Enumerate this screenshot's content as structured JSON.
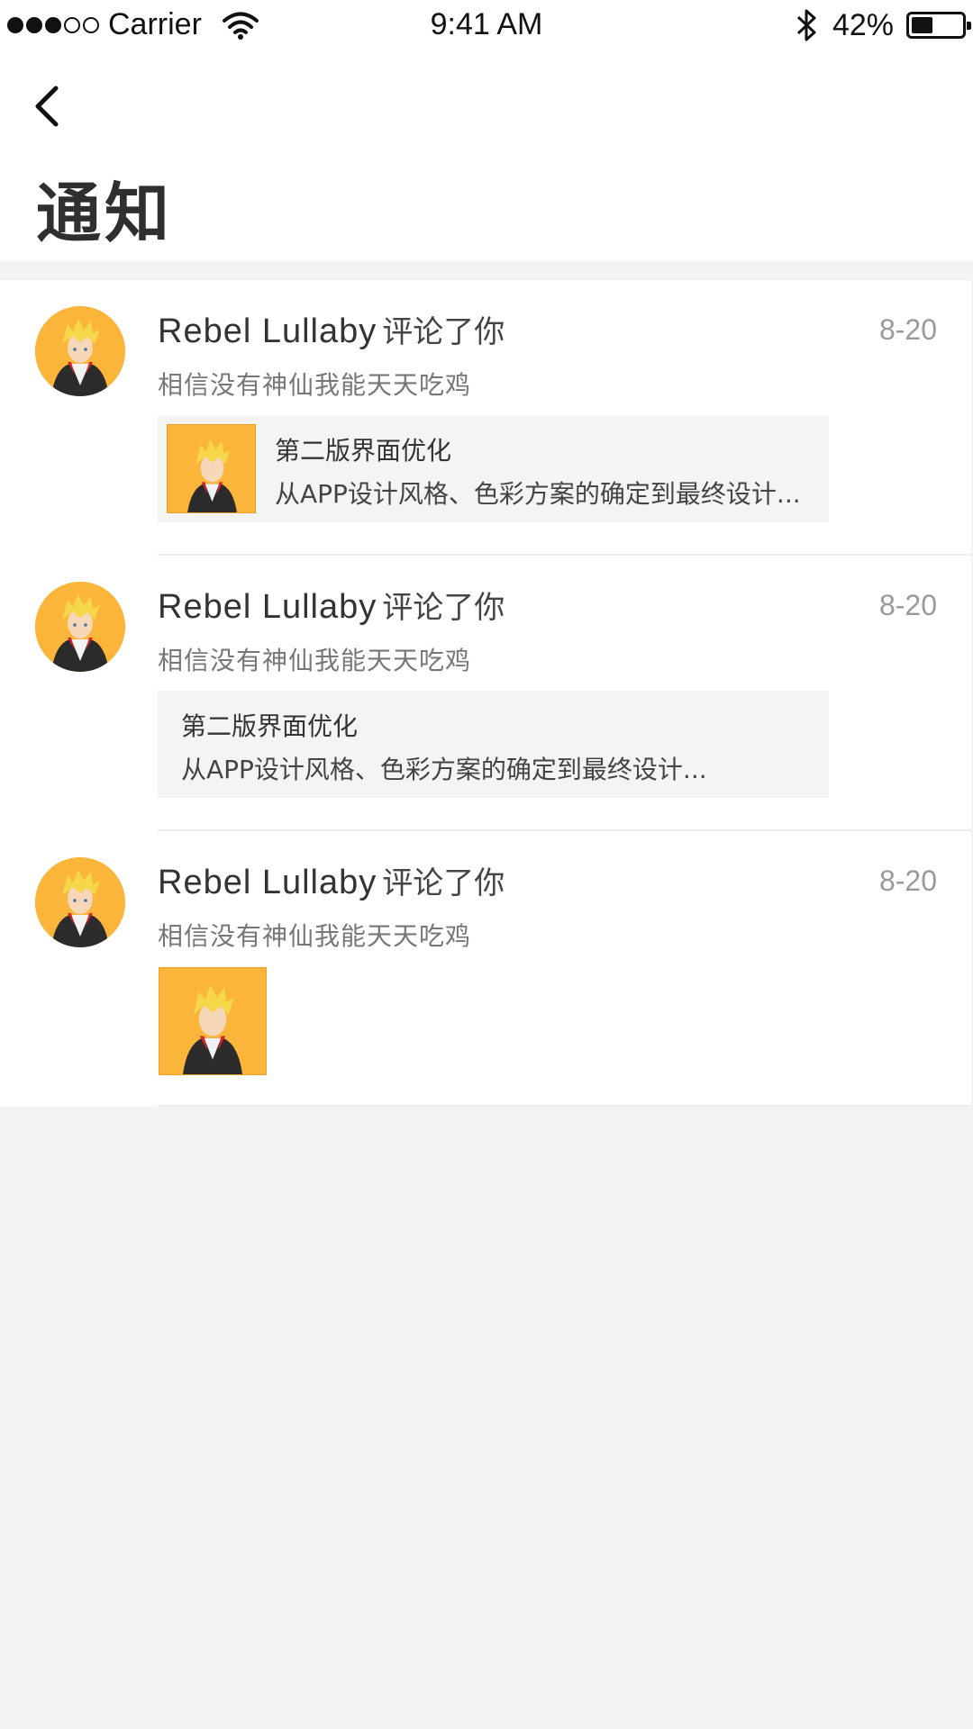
{
  "status_bar": {
    "carrier": "Carrier",
    "time": "9:41 AM",
    "battery": "42%",
    "battery_level": 0.42
  },
  "header": {
    "title": "通知"
  },
  "notifications": [
    {
      "name": "Rebel Lullaby",
      "action": "评论了你",
      "date": "8-20",
      "comment": "相信没有神仙我能天天吃鸡",
      "card": {
        "title": "第二版界面优化",
        "desc": "从APP设计风格、色彩方案的确定到最终设计..."
      }
    },
    {
      "name": "Rebel Lullaby",
      "action": "评论了你",
      "date": "8-20",
      "comment": "相信没有神仙我能天天吃鸡",
      "card": {
        "title": "第二版界面优化",
        "desc": "从APP设计风格、色彩方案的确定到最终设计..."
      }
    },
    {
      "name": "Rebel Lullaby",
      "action": "评论了你",
      "date": "8-20",
      "comment": "相信没有神仙我能天天吃鸡"
    }
  ],
  "colors": {
    "accent_orange": "#fbb53b",
    "background": "#f3f3f3",
    "card_background": "#f4f4f4",
    "date_gray": "#9a9a9a"
  }
}
